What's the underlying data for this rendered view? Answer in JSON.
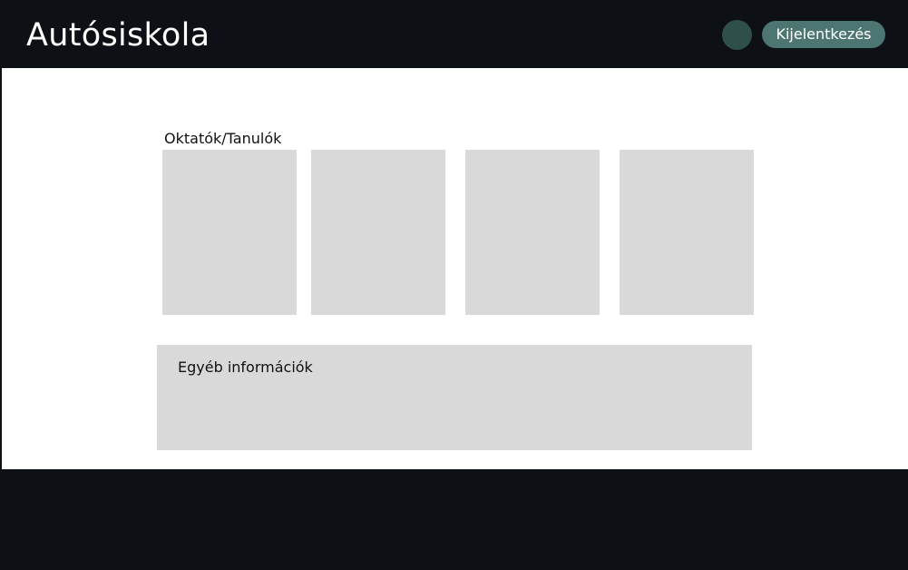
{
  "header": {
    "brand": "Autósiskola",
    "logout_label": "Kijelentkezés"
  },
  "main": {
    "section_title": "Oktatók/Tanulók",
    "card_count": 4,
    "info_title": "Egyéb információk"
  },
  "colors": {
    "background_dark": "#0d1116",
    "avatar": "#2f4f4b",
    "logout_button": "#4d7572",
    "card": "#d9d9d9",
    "content": "#ffffff"
  }
}
